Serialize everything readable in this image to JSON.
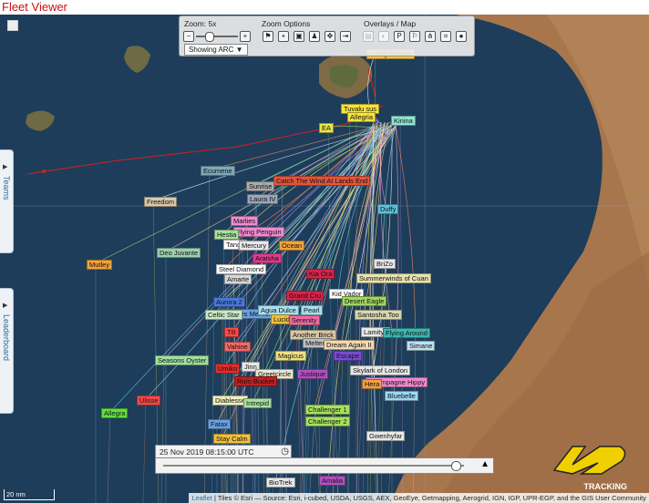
{
  "window": {
    "title": "Fleet Viewer"
  },
  "zoom": {
    "label": "Zoom: 5x",
    "minus": "−",
    "plus": "+",
    "level_fraction": 0.3
  },
  "zoom_options": {
    "label": "Zoom Options"
  },
  "overlays": {
    "label": "Overlays / Map"
  },
  "showing": {
    "label": "Showing ARC"
  },
  "tabs": {
    "teams": "Teams",
    "leaderboard": "Leaderboard"
  },
  "timeline": {
    "datetime": "25 Nov 2019 08:15:00 UTC",
    "position_fraction": 0.97
  },
  "scale": {
    "label": "20 nm"
  },
  "attribution": {
    "leaflet": "Leaflet",
    "text": "| Tiles © Esri — Source: Esri, i-cubed, USDA, USGS, AEX, GeoEye, Getmapping, Aerogrid, IGN, IGP, UPR-EGP, and the GIS User Community"
  },
  "logo": {
    "text": "TRACKING"
  },
  "boats": [
    {
      "name": "Laddy Borradi",
      "color": "#f6c33a"
    },
    {
      "name": "Tuvalu sus",
      "color": "#f6e43a"
    },
    {
      "name": "Allegria",
      "color": "#f6e43a"
    },
    {
      "name": "Kinina",
      "color": "#8fe4d2"
    },
    {
      "name": "EA",
      "color": "#e8e54a"
    },
    {
      "name": "Ecumene",
      "color": "#7fa9b8"
    },
    {
      "name": "Catch The Wind At Lands End",
      "color": "#e3553b"
    },
    {
      "name": "Sunrise",
      "color": "#aaaaaa"
    },
    {
      "name": "Laura IV",
      "color": "#9ba6b8"
    },
    {
      "name": "Freedom",
      "color": "#d9c8a8"
    },
    {
      "name": "Duffy",
      "color": "#5fc0d8"
    },
    {
      "name": "Marlies",
      "color": "#f08bd0"
    },
    {
      "name": "Flying Penguin",
      "color": "#f08bd0"
    },
    {
      "name": "Hestia",
      "color": "#a8e0a0"
    },
    {
      "name": "Tango",
      "color": "#ffffff"
    },
    {
      "name": "Mercury",
      "color": "#e8e8e8"
    },
    {
      "name": "Ocean",
      "color": "#f2a33a"
    },
    {
      "name": "Deo Juvante",
      "color": "#9bd0b0"
    },
    {
      "name": "Aratsha",
      "color": "#e03c8c"
    },
    {
      "name": "Kia Ora",
      "color": "#d8244a"
    },
    {
      "name": "BriZo",
      "color": "#e8e8e8"
    },
    {
      "name": "Summerwinds of Cuan",
      "color": "#e8e4b0"
    },
    {
      "name": "Mutley",
      "color": "#f2a33a"
    },
    {
      "name": "Steel Diamond",
      "color": "#ffffff"
    },
    {
      "name": "Amarte",
      "color": "#d8d8d8"
    },
    {
      "name": "Kid Vador",
      "color": "#ffffff"
    },
    {
      "name": "Desert Eagle",
      "color": "#a0d860"
    },
    {
      "name": "Aurora 2",
      "color": "#4a78d8"
    },
    {
      "name": "Octaves Memories",
      "color": "#6aa0e0"
    },
    {
      "name": "Grand Cru",
      "color": "#d8244a"
    },
    {
      "name": "Santosha Too",
      "color": "#d8d8b0"
    },
    {
      "name": "Celtic Star",
      "color": "#c8e8c8"
    },
    {
      "name": "Agua Dulce",
      "color": "#a8e0f0"
    },
    {
      "name": "Lucid",
      "color": "#f0c040"
    },
    {
      "name": "Serenity",
      "color": "#f06aa0"
    },
    {
      "name": "Pearl",
      "color": "#a8e0f0"
    },
    {
      "name": "Lamitye",
      "color": "#e8e8e8"
    },
    {
      "name": "Flying Around",
      "color": "#3ab8b0"
    },
    {
      "name": "Tilt",
      "color": "#ff4a4a"
    },
    {
      "name": "Another Brick",
      "color": "#d8c8a8"
    },
    {
      "name": "Meltemi",
      "color": "#c0c0c0"
    },
    {
      "name": "Simane",
      "color": "#c0e0f0"
    },
    {
      "name": "Vahine",
      "color": "#f06a6a"
    },
    {
      "name": "Magicus",
      "color": "#f0e080"
    },
    {
      "name": "Dream Again II",
      "color": "#f0d8b0"
    },
    {
      "name": "Escape",
      "color": "#7a4ad8"
    },
    {
      "name": "Seasons Oyster",
      "color": "#a0e0a0"
    },
    {
      "name": "Umiko",
      "color": "#e03030"
    },
    {
      "name": "Jinn",
      "color": "#e8e8e8"
    },
    {
      "name": "Greetcircle",
      "color": "#e8e8d0"
    },
    {
      "name": "Justique",
      "color": "#b050c0"
    },
    {
      "name": "Skylark of London",
      "color": "#e8e8e8"
    },
    {
      "name": "Rum Bucket",
      "color": "#c02020"
    },
    {
      "name": "Champagne Hippy",
      "color": "#f08bd0"
    },
    {
      "name": "Hera",
      "color": "#f0a040"
    },
    {
      "name": "Bluebelle",
      "color": "#a0d8f0"
    },
    {
      "name": "Ulisse",
      "color": "#f04a4a"
    },
    {
      "name": "Diablesse",
      "color": "#f0f0c0"
    },
    {
      "name": "Intrepid",
      "color": "#a8e0a0"
    },
    {
      "name": "Challenger 1",
      "color": "#a8e060"
    },
    {
      "name": "Challenger 2",
      "color": "#a8e060"
    },
    {
      "name": "Allegra",
      "color": "#60e040"
    },
    {
      "name": "Fatax",
      "color": "#6aa0e0"
    },
    {
      "name": "Gwenhyfar",
      "color": "#e8e8e8"
    },
    {
      "name": "Stay Calm",
      "color": "#f0c040"
    },
    {
      "name": "BioTrek",
      "color": "#e8e8e8"
    },
    {
      "name": "Amalia",
      "color": "#b050c0"
    }
  ]
}
